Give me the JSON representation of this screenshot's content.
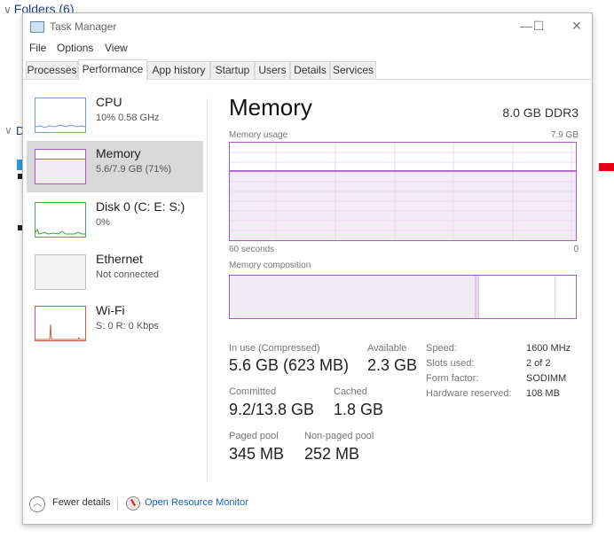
{
  "background": {
    "folders_label": "Folders (6)",
    "second_group_initial": "D"
  },
  "window": {
    "title": "Task Manager",
    "controls": {
      "minimize": "—",
      "maximize": "☐",
      "close": "✕"
    }
  },
  "menu": [
    "File",
    "Options",
    "View"
  ],
  "tabs": [
    {
      "label": "Processes",
      "active": false
    },
    {
      "label": "Performance",
      "active": true
    },
    {
      "label": "App history",
      "active": false
    },
    {
      "label": "Startup",
      "active": false
    },
    {
      "label": "Users",
      "active": false
    },
    {
      "label": "Details",
      "active": false
    },
    {
      "label": "Services",
      "active": false
    }
  ],
  "sidebar": {
    "items": [
      {
        "title": "CPU",
        "subtitle": "10% 0.58 GHz",
        "color": "#6b9bd2",
        "active": false
      },
      {
        "title": "Memory",
        "subtitle": "5.6/7.9 GB (71%)",
        "color": "#a55bc2",
        "active": true
      },
      {
        "title": "Disk 0 (C: E: S:)",
        "subtitle": "0%",
        "color": "#4caf50",
        "active": false
      },
      {
        "title": "Ethernet",
        "subtitle": "Not connected",
        "color": "#bdbdbd",
        "active": false
      },
      {
        "title": "Wi-Fi",
        "subtitle": "S: 0 R: 0 Kbps",
        "color": "#c86040",
        "active": false
      }
    ]
  },
  "main": {
    "title": "Memory",
    "spec": "8.0 GB DDR3",
    "usage_label": "Memory usage",
    "usage_max": "7.9 GB",
    "axis_left": "60 seconds",
    "axis_right": "0",
    "usage_fraction": 0.71,
    "composition_label": "Memory composition",
    "composition": {
      "in_use_fraction": 0.71,
      "modified_fraction": 0.01,
      "standby_fraction": 0.22,
      "free_fraction": 0.06
    },
    "stats": {
      "in_use_label": "In use (Compressed)",
      "in_use_value": "5.6 GB (623 MB)",
      "available_label": "Available",
      "available_value": "2.3 GB",
      "committed_label": "Committed",
      "committed_value": "9.2/13.8 GB",
      "cached_label": "Cached",
      "cached_value": "1.8 GB",
      "paged_label": "Paged pool",
      "paged_value": "345 MB",
      "nonpaged_label": "Non-paged pool",
      "nonpaged_value": "252 MB"
    },
    "specs": [
      {
        "label": "Speed:",
        "value": "1600 MHz"
      },
      {
        "label": "Slots used:",
        "value": "2 of 2"
      },
      {
        "label": "Form factor:",
        "value": "SODIMM"
      },
      {
        "label": "Hardware reserved:",
        "value": "108 MB"
      }
    ]
  },
  "footer": {
    "fewer_details": "Fewer details",
    "resource_monitor": "Open Resource Monitor"
  }
}
